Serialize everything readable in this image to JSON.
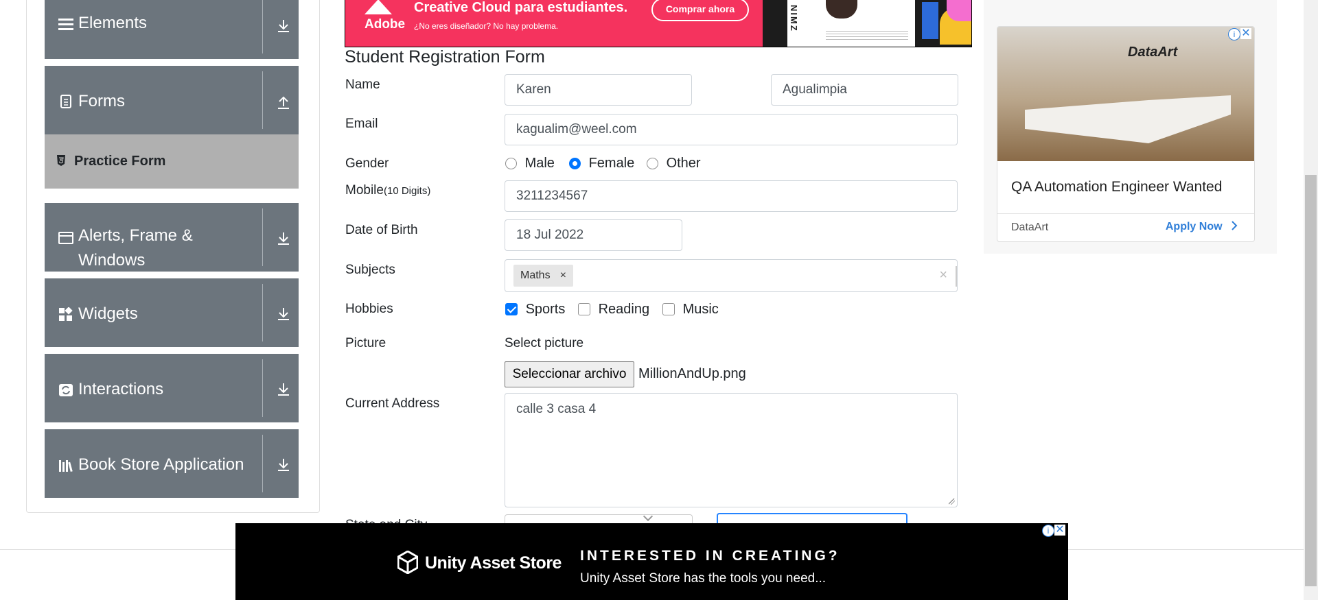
{
  "sidebar": {
    "groups": [
      {
        "label": "Elements",
        "icon": "hamburger-icon",
        "arrow": "download-arrow-icon"
      },
      {
        "label": "Forms",
        "icon": "document-icon",
        "arrow": "upload-arrow-icon"
      },
      {
        "label": "Alerts, Frame &",
        "label2": "Windows",
        "icon": "window-icon",
        "arrow": "download-arrow-icon"
      },
      {
        "label": "Widgets",
        "icon": "widgets-icon",
        "arrow": "download-arrow-icon"
      },
      {
        "label": "Interactions",
        "icon": "interactions-icon",
        "arrow": "download-arrow-icon"
      },
      {
        "label": "Book Store Application",
        "icon": "books-icon",
        "arrow": "download-arrow-icon"
      }
    ],
    "active_item": {
      "label": "Practice Form",
      "icon": "html-icon"
    }
  },
  "top_ad": {
    "brand": "Adobe",
    "headline": "Creative Cloud para estudiantes.",
    "subline": "¿No eres diseñador? No hay problema.",
    "cta": "Comprar ahora",
    "vertical_text": "NIMZ",
    "colors": {
      "bg": "#f5335e"
    }
  },
  "form": {
    "title": "Student Registration Form",
    "name_label": "Name",
    "first_name": "Karen",
    "last_name": "Agualimpia",
    "email_label": "Email",
    "email": "kagualim@weel.com",
    "gender_label": "Gender",
    "genders": [
      "Male",
      "Female",
      "Other"
    ],
    "gender_selected": "Female",
    "mobile_label": "Mobile",
    "mobile_hint": "(10 Digits)",
    "mobile": "3211234567",
    "dob_label": "Date of Birth",
    "dob": "18 Jul 2022",
    "subjects_label": "Subjects",
    "subjects": [
      "Maths"
    ],
    "subject_remove": "×",
    "subjects_clear": "×",
    "hobbies_label": "Hobbies",
    "hobbies": [
      {
        "label": "Sports",
        "checked": true
      },
      {
        "label": "Reading",
        "checked": false
      },
      {
        "label": "Music",
        "checked": false
      }
    ],
    "picture_label": "Picture",
    "select_picture": "Select picture",
    "file_button": "Seleccionar archivo",
    "file_name": "MillionAndUp.png",
    "address_label": "Current Address",
    "address": "calle 3 casa 4",
    "state_city_label": "State and City"
  },
  "right_ad": {
    "logo": "DataArt",
    "title": "QA Automation Engineer Wanted",
    "brand": "DataArt",
    "cta": "Apply Now",
    "info": "i",
    "close": "✕"
  },
  "bottom_ad": {
    "brand": "Unity Asset Store",
    "headline": "INTERESTED IN CREATING?",
    "subline": "Unity Asset Store has the tools you need...",
    "info": "i",
    "close": "✕"
  },
  "colors": {
    "sidebar_group": "#6c757d",
    "active_item": "#b0b0b0",
    "accent": "#0075ff"
  }
}
